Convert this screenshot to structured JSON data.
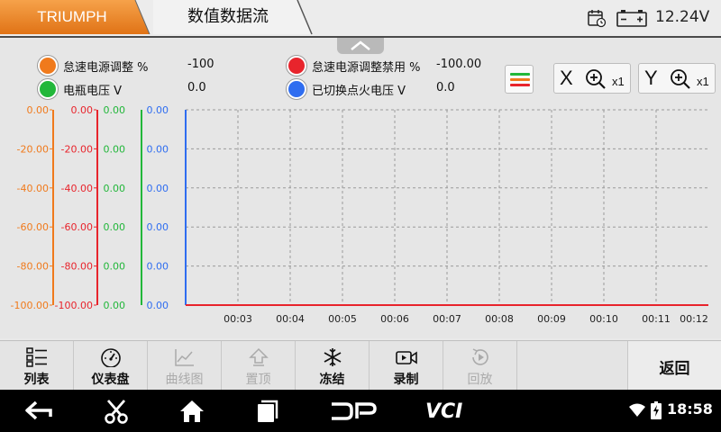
{
  "header": {
    "brand": "TRIUMPH",
    "title": "数值数据流",
    "voltage": "12.24V"
  },
  "legend": [
    {
      "name": "怠速电源调整  %",
      "value": "-100",
      "color": "#f07a1c"
    },
    {
      "name": "怠速电源调整禁用  %",
      "value": "-100.00",
      "color": "#e8242c"
    },
    {
      "name": "电瓶电压  V",
      "value": "0.0",
      "color": "#22b73a"
    },
    {
      "name": "已切换点火电压  V",
      "value": "0.0",
      "color": "#2f6df0"
    }
  ],
  "zoom": {
    "x_axis": "X",
    "x_factor": "x1",
    "y_axis": "Y",
    "y_factor": "x1"
  },
  "chart_data": {
    "type": "line",
    "title": "",
    "xlabel": "",
    "ylabel": "",
    "x_ticks": [
      "00:03",
      "00:04",
      "00:05",
      "00:06",
      "00:07",
      "00:08",
      "00:09",
      "00:10",
      "00:11",
      "00:12"
    ],
    "grid": true,
    "axes": [
      {
        "color": "#f07a1c",
        "ticks": [
          "0.00",
          "-20.00",
          "-40.00",
          "-60.00",
          "-80.00",
          "-100.00"
        ],
        "ylim": [
          -100,
          0
        ]
      },
      {
        "color": "#e8242c",
        "ticks": [
          "0.00",
          "-20.00",
          "-40.00",
          "-60.00",
          "-80.00",
          "-100.00"
        ],
        "ylim": [
          -100,
          0
        ]
      },
      {
        "color": "#22b73a",
        "ticks": [
          "0.00",
          "0.00",
          "0.00",
          "0.00",
          "0.00",
          "0.00"
        ],
        "ylim": [
          0,
          0
        ]
      },
      {
        "color": "#2f6df0",
        "ticks": [
          "0.00",
          "0.00",
          "0.00",
          "0.00",
          "0.00",
          "0.00"
        ],
        "ylim": [
          0,
          0
        ]
      }
    ],
    "series": [
      {
        "color": "#e8242c",
        "values": [
          -100,
          -100,
          -100,
          -100,
          -100,
          -100,
          -100,
          -100,
          -100,
          -100
        ]
      }
    ]
  },
  "toolbar": {
    "list": "列表",
    "dashboard": "仪表盘",
    "graph": "曲线图",
    "top": "置顶",
    "freeze": "冻结",
    "record": "录制",
    "playback": "回放",
    "back": "返回"
  },
  "navbar": {
    "clock": "18:58",
    "logo_dp": "DP",
    "logo_vci": "VCI"
  }
}
